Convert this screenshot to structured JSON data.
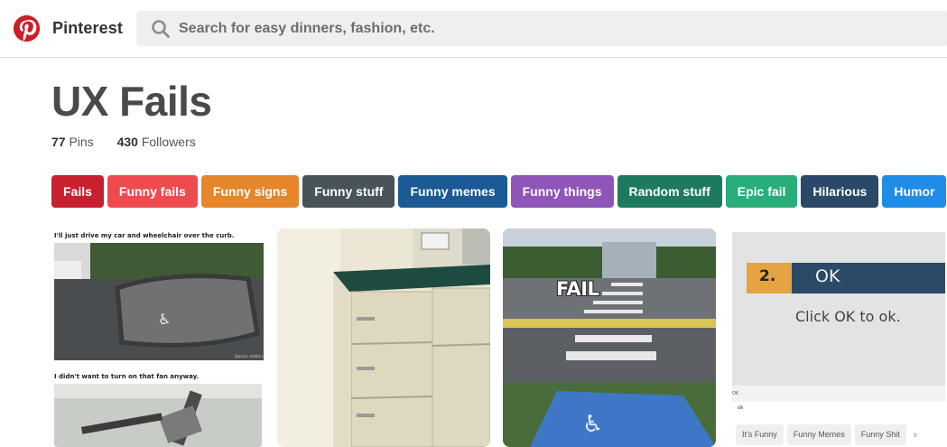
{
  "header": {
    "brand": "Pinterest",
    "search_placeholder": "Search for easy dinners, fashion, etc.",
    "logo_icon": "pinterest-logo-icon",
    "search_icon": "search-icon",
    "brand_color": "#cb1f27"
  },
  "board": {
    "title": "UX Fails",
    "pins_count": "77",
    "pins_label": "Pins",
    "followers_count": "430",
    "followers_label": "Followers"
  },
  "tags": [
    {
      "label": "Fails",
      "color": "#c8202f"
    },
    {
      "label": "Funny fails",
      "color": "#ef4b4f"
    },
    {
      "label": "Funny signs",
      "color": "#e5862a"
    },
    {
      "label": "Funny stuff",
      "color": "#48545a"
    },
    {
      "label": "Funny memes",
      "color": "#1b5a94"
    },
    {
      "label": "Funny things",
      "color": "#8f55b8"
    },
    {
      "label": "Random stuff",
      "color": "#1d7a5e"
    },
    {
      "label": "Epic fail",
      "color": "#27ae7b"
    },
    {
      "label": "Hilarious",
      "color": "#2a4868"
    },
    {
      "label": "Humor",
      "color": "#1f8ce8"
    }
  ],
  "pins": {
    "pin1": {
      "caption_top": "I'll just drive my car and wheelchair over the curb.",
      "caption_bottom": "I didn't want to turn on that fan anyway."
    },
    "pin3": {
      "overlay_text": "FAIL"
    },
    "pin4": {
      "step_number": "2.",
      "step_label": "OK",
      "body_text": "Click OK to ok.",
      "small_text_1": "OK",
      "small_text_2": "ok",
      "related_tags": [
        "It's Funny",
        "Funny Memes",
        "Funny Shit"
      ],
      "more_icon": "chevron-right-icon"
    }
  }
}
